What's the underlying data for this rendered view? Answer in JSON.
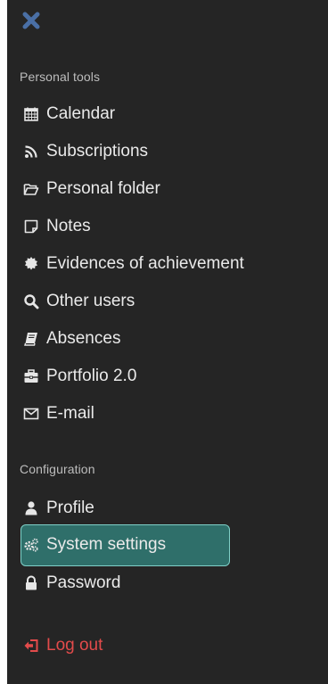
{
  "sections": [
    {
      "title": "Personal tools",
      "items": [
        {
          "label": "Calendar",
          "icon": "calendar-icon"
        },
        {
          "label": "Subscriptions",
          "icon": "rss-icon"
        },
        {
          "label": "Personal folder",
          "icon": "folder-open-icon"
        },
        {
          "label": "Notes",
          "icon": "note-icon"
        },
        {
          "label": "Evidences of achievement",
          "icon": "badge-icon"
        },
        {
          "label": "Other users",
          "icon": "search-icon"
        },
        {
          "label": "Absences",
          "icon": "book-icon"
        },
        {
          "label": "Portfolio 2.0",
          "icon": "briefcase-icon"
        },
        {
          "label": "E-mail",
          "icon": "envelope-icon"
        }
      ]
    },
    {
      "title": "Configuration",
      "items": [
        {
          "label": "Profile",
          "icon": "user-icon"
        },
        {
          "label": "System settings",
          "icon": "cogs-icon",
          "active": true
        },
        {
          "label": "Password",
          "icon": "lock-icon"
        }
      ]
    }
  ],
  "logout": {
    "label": "Log out",
    "icon": "sign-out-icon"
  },
  "colors": {
    "panel_bg": "#252525",
    "text": "#eaeaea",
    "section_title": "#bdbdbd",
    "accent_close": "#4a6fa5",
    "active_bg": "#2f6f6a",
    "active_border": "#7fd0c8",
    "logout": "#e34b4b"
  }
}
